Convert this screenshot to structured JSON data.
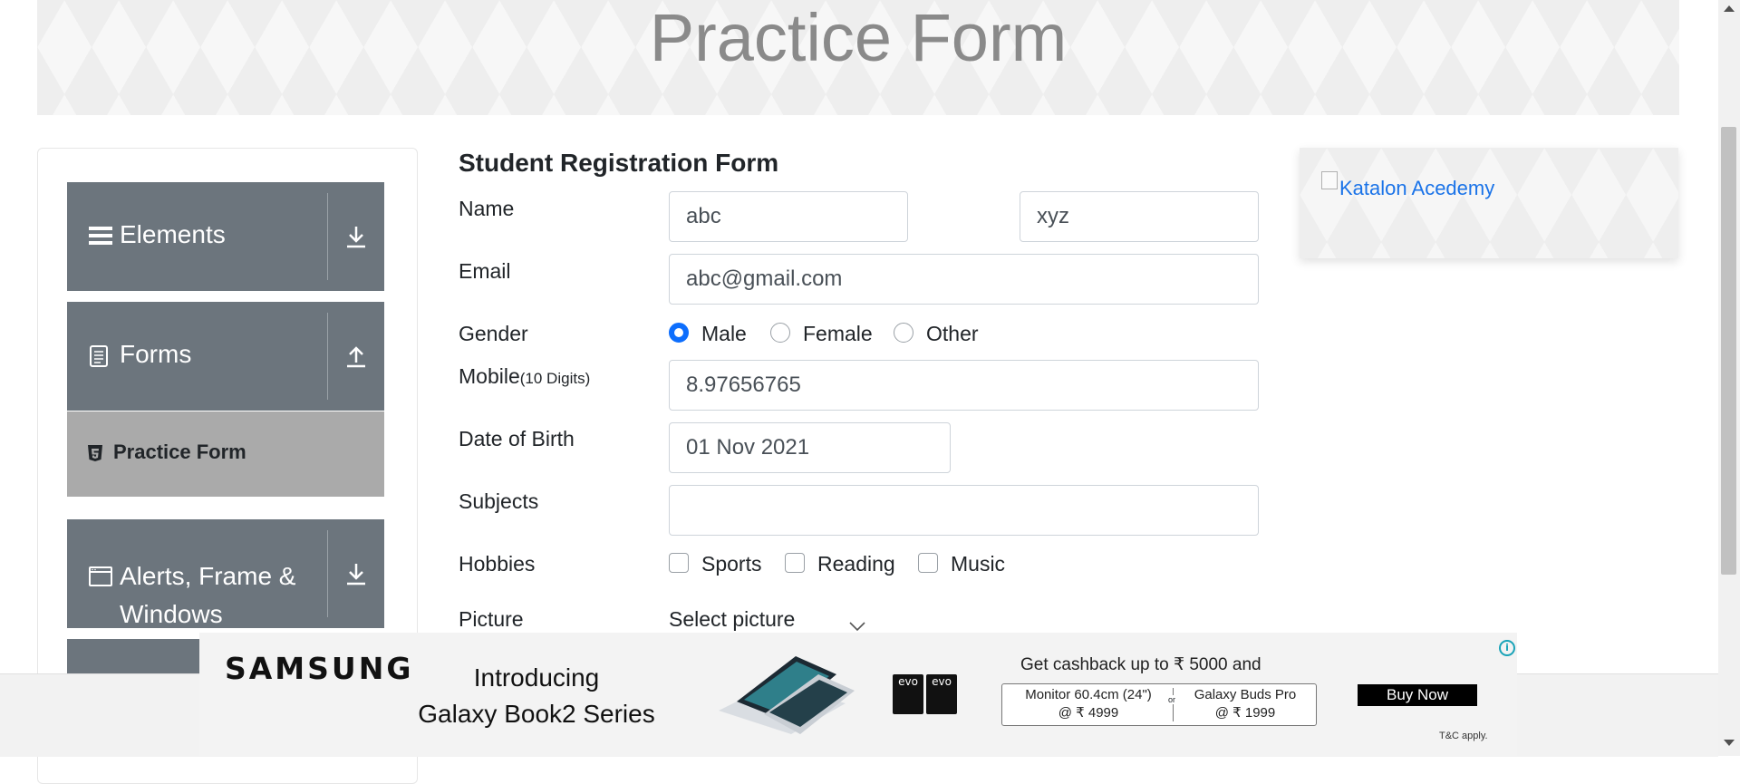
{
  "banner": {
    "title": "Practice Form"
  },
  "sidebar": {
    "groups": [
      {
        "label": "Elements",
        "icon": "list-icon",
        "arrow": "download-arrow-icon"
      },
      {
        "label": "Forms",
        "icon": "document-icon",
        "arrow": "upload-arrow-icon"
      },
      {
        "label_line1": "Alerts, Frame &",
        "label_line2": "Windows",
        "icon": "window-icon",
        "arrow": "download-arrow-icon"
      }
    ],
    "active_item": {
      "label": "Practice Form",
      "icon": "html5-icon"
    }
  },
  "form": {
    "title": "Student Registration Form",
    "name_label": "Name",
    "first_name": "abc",
    "last_name": "xyz",
    "email_label": "Email",
    "email": "abc@gmail.com",
    "gender_label": "Gender",
    "gender_options": [
      "Male",
      "Female",
      "Other"
    ],
    "gender_selected": "Male",
    "mobile_label": "Mobile",
    "mobile_hint": "(10 Digits)",
    "mobile": "8.97656765",
    "dob_label": "Date of Birth",
    "dob": "01 Nov 2021",
    "subjects_label": "Subjects",
    "subjects": "",
    "hobbies_label": "Hobbies",
    "hobbies": [
      "Sports",
      "Reading",
      "Music"
    ],
    "picture_label": "Picture",
    "picture_button": "Select picture"
  },
  "side_ad": {
    "alt_text": "Katalon Acedemy"
  },
  "bottom_ad": {
    "brand": "SAMSUNG",
    "headline_line1": "Introducing",
    "headline_line2": "Galaxy Book2 Series",
    "badge": "evo",
    "cashback": "Get cashback up to ₹ 5000 and",
    "deal1_line1": "Monitor 60.4cm (24\")",
    "deal1_line2": "@ ₹ 4999",
    "deal_sep": "or",
    "deal2_line1": "Galaxy Buds Pro",
    "deal2_line2": "@ ₹ 1999",
    "cta": "Buy Now",
    "terms": "T&C apply."
  }
}
